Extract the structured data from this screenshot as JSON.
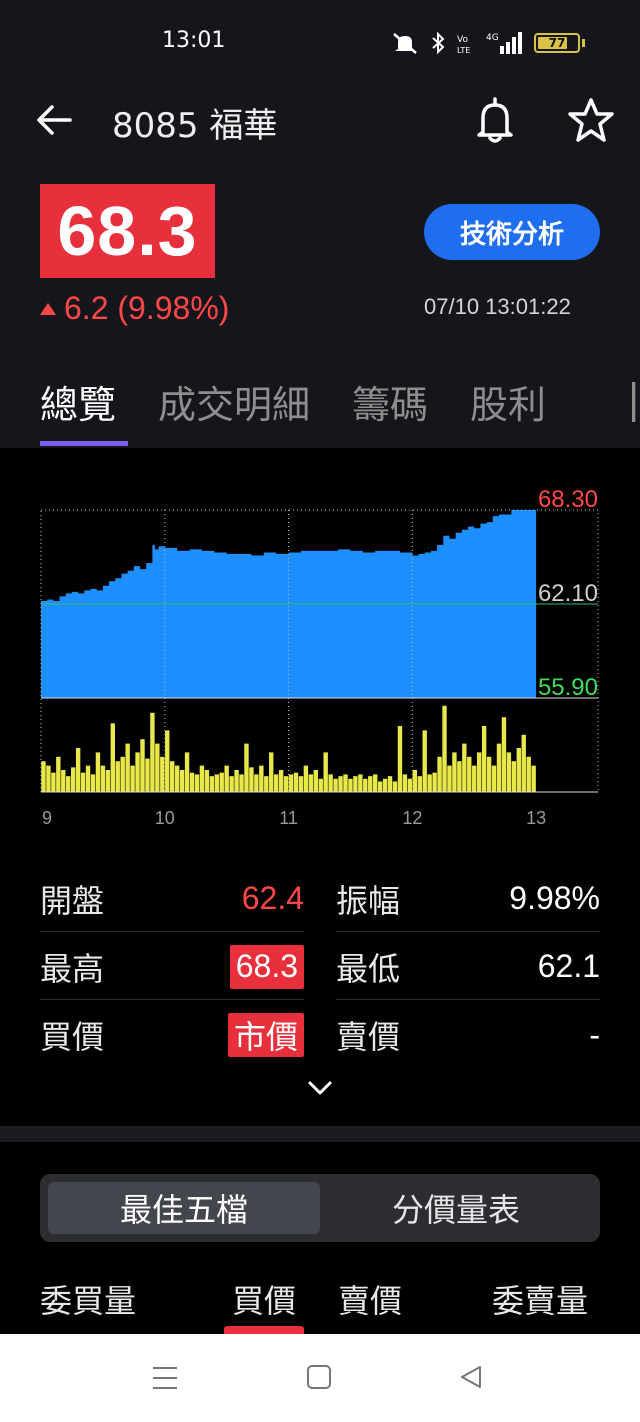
{
  "status_bar": {
    "time": "13:01",
    "battery_level": "77",
    "icons": [
      "mute-icon",
      "bluetooth-icon",
      "volte-icon",
      "4g-signal-icon",
      "battery-icon"
    ]
  },
  "header": {
    "title": "8085 福華",
    "back_icon": "arrow-left-icon",
    "alert_icon": "bell-icon",
    "favorite_icon": "star-icon"
  },
  "quote": {
    "price": "68.3",
    "change": "6.2 (9.98%)",
    "direction": "up",
    "timestamp": "07/10 13:01:22",
    "tech_button": "技術分析"
  },
  "tabs": [
    {
      "label": "總覽",
      "active": true
    },
    {
      "label": "成交明細",
      "active": false
    },
    {
      "label": "籌碼",
      "active": false
    },
    {
      "label": "股利",
      "active": false
    }
  ],
  "chart_data": {
    "type": "area",
    "x_tick_labels": [
      "9",
      "10",
      "11",
      "12",
      "13"
    ],
    "y_ticks": [
      {
        "label": "68.30",
        "value": 68.3,
        "color": "#ff4747"
      },
      {
        "label": "62.10",
        "value": 62.1,
        "color": "#cfcfcf"
      },
      {
        "label": "55.90",
        "value": 55.9,
        "color": "#3ddc5a"
      }
    ],
    "ylim": [
      55.9,
      68.3
    ],
    "xlim": [
      9.0,
      13.5
    ],
    "reference_price": 62.1,
    "price_series": {
      "x": [
        9.0,
        9.05,
        9.1,
        9.15,
        9.2,
        9.25,
        9.3,
        9.35,
        9.4,
        9.45,
        9.5,
        9.55,
        9.6,
        9.65,
        9.7,
        9.75,
        9.8,
        9.85,
        9.9,
        9.92,
        9.95,
        10.0,
        10.1,
        10.2,
        10.3,
        10.4,
        10.5,
        10.6,
        10.7,
        10.8,
        10.9,
        11.0,
        11.1,
        11.2,
        11.3,
        11.4,
        11.5,
        11.6,
        11.7,
        11.8,
        11.9,
        12.0,
        12.05,
        12.1,
        12.15,
        12.2,
        12.25,
        12.3,
        12.35,
        12.4,
        12.45,
        12.5,
        12.55,
        12.6,
        12.65,
        12.7,
        12.8,
        12.9,
        13.0
      ],
      "y": [
        62.3,
        62.4,
        62.3,
        62.6,
        62.8,
        62.9,
        62.8,
        63.0,
        63.1,
        63.0,
        63.3,
        63.6,
        63.8,
        64.1,
        64.3,
        64.6,
        64.4,
        64.8,
        66.0,
        65.7,
        65.9,
        65.8,
        65.6,
        65.7,
        65.6,
        65.5,
        65.4,
        65.4,
        65.3,
        65.5,
        65.4,
        65.5,
        65.6,
        65.6,
        65.6,
        65.7,
        65.6,
        65.5,
        65.6,
        65.6,
        65.5,
        65.3,
        65.4,
        65.5,
        65.6,
        66.0,
        66.6,
        66.4,
        66.8,
        67.0,
        67.2,
        67.1,
        67.4,
        67.5,
        67.9,
        68.0,
        68.3,
        68.3,
        68.3
      ]
    },
    "volume_series": {
      "x": [
        9.02,
        9.06,
        9.1,
        9.14,
        9.18,
        9.22,
        9.26,
        9.3,
        9.34,
        9.38,
        9.42,
        9.46,
        9.5,
        9.54,
        9.58,
        9.62,
        9.66,
        9.7,
        9.74,
        9.78,
        9.82,
        9.86,
        9.9,
        9.94,
        9.98,
        10.02,
        10.06,
        10.1,
        10.14,
        10.18,
        10.22,
        10.26,
        10.3,
        10.34,
        10.38,
        10.42,
        10.46,
        10.5,
        10.54,
        10.58,
        10.62,
        10.66,
        10.7,
        10.74,
        10.78,
        10.82,
        10.86,
        10.9,
        10.94,
        10.98,
        11.02,
        11.06,
        11.1,
        11.14,
        11.18,
        11.22,
        11.26,
        11.3,
        11.34,
        11.38,
        11.42,
        11.46,
        11.5,
        11.54,
        11.58,
        11.62,
        11.66,
        11.7,
        11.74,
        11.78,
        11.82,
        11.86,
        11.9,
        11.94,
        11.98,
        12.02,
        12.06,
        12.1,
        12.14,
        12.18,
        12.22,
        12.26,
        12.3,
        12.34,
        12.38,
        12.42,
        12.46,
        12.5,
        12.54,
        12.58,
        12.62,
        12.66,
        12.7,
        12.74,
        12.78,
        12.82,
        12.86,
        12.9,
        12.94,
        12.98
      ],
      "relative": [
        0.35,
        0.3,
        0.22,
        0.4,
        0.25,
        0.18,
        0.28,
        0.5,
        0.22,
        0.3,
        0.2,
        0.45,
        0.3,
        0.25,
        0.78,
        0.35,
        0.4,
        0.55,
        0.3,
        0.45,
        0.6,
        0.38,
        0.9,
        0.55,
        0.4,
        0.7,
        0.35,
        0.3,
        0.25,
        0.45,
        0.22,
        0.2,
        0.3,
        0.25,
        0.18,
        0.2,
        0.22,
        0.3,
        0.18,
        0.25,
        0.2,
        0.55,
        0.28,
        0.2,
        0.3,
        0.18,
        0.45,
        0.2,
        0.25,
        0.18,
        0.2,
        0.22,
        0.18,
        0.3,
        0.2,
        0.25,
        0.15,
        0.45,
        0.2,
        0.15,
        0.18,
        0.2,
        0.15,
        0.18,
        0.2,
        0.15,
        0.18,
        0.2,
        0.12,
        0.15,
        0.18,
        0.12,
        0.75,
        0.2,
        0.15,
        0.25,
        0.18,
        0.7,
        0.2,
        0.22,
        0.4,
        0.98,
        0.3,
        0.45,
        0.35,
        0.55,
        0.4,
        0.3,
        0.45,
        0.75,
        0.4,
        0.3,
        0.55,
        0.85,
        0.45,
        0.35,
        0.5,
        0.65,
        0.4,
        0.3
      ]
    },
    "grid": true,
    "xlabel": "",
    "ylabel": ""
  },
  "stats": [
    {
      "label": "開盤",
      "value": "62.4",
      "style": "red"
    },
    {
      "label": "振幅",
      "value": "9.98%",
      "style": "white"
    },
    {
      "label": "最高",
      "value": "68.3",
      "style": "boxed"
    },
    {
      "label": "最低",
      "value": "62.1",
      "style": "white"
    },
    {
      "label": "買價",
      "value": "市價",
      "style": "boxed"
    },
    {
      "label": "賣價",
      "value": "-",
      "style": "white"
    }
  ],
  "expand_icon": "chevron-down-icon",
  "orderbook": {
    "toggle": [
      {
        "label": "最佳五檔",
        "active": true
      },
      {
        "label": "分價量表",
        "active": false
      }
    ],
    "headers": [
      "委買量",
      "買價",
      "賣價",
      "委賣量"
    ]
  },
  "nav_bar": {
    "icons": [
      "menu-icon",
      "home-icon",
      "back-triangle-icon"
    ]
  },
  "colors": {
    "up": "#ff4747",
    "price_box": "#e8303c",
    "accent_blue": "#1f6ef0",
    "tab_indicator": "#7b5cf0",
    "area_fill": "#1d8fff",
    "volume": "#e8e84a",
    "low_label": "#3ddc5a"
  }
}
